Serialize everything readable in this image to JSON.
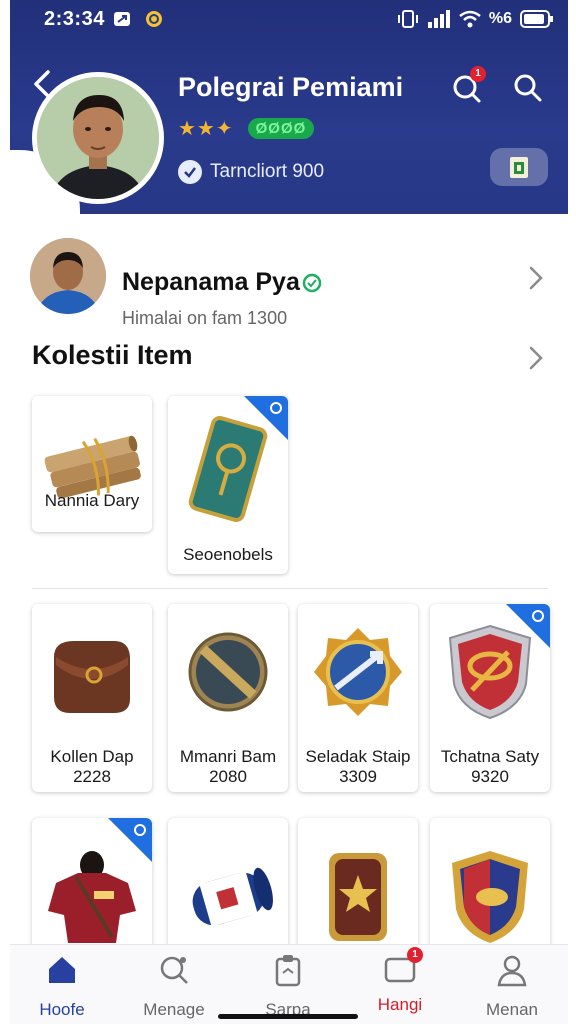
{
  "status_bar": {
    "time": "2:3:34",
    "battery": "%6"
  },
  "profile": {
    "name": "Polegrai Pemiami",
    "stars": "★★✦",
    "rank": "ØØØØ",
    "subtitle": "Tarncliort 900",
    "notification_count": "1"
  },
  "friend": {
    "name": "Nepanama Pya",
    "subtitle": "Himalai on fam 1300"
  },
  "collection": {
    "title": "Kolestii Item",
    "featured": [
      {
        "label": "Nannia Dary",
        "icon": "scroll-bundle-icon",
        "tag": false
      },
      {
        "label": "Seoenobels",
        "icon": "teal-card-icon",
        "tag": true
      }
    ],
    "items": [
      {
        "label": "Kollen Dap",
        "value": "2228",
        "icon": "leather-pouch-icon",
        "tag": false
      },
      {
        "label": "Mmanri Bam",
        "value": "2080",
        "icon": "bronze-coin-icon",
        "tag": false
      },
      {
        "label": "Seladak Staip",
        "value": "3309",
        "icon": "gold-emblem-icon",
        "tag": false
      },
      {
        "label": "Tchatna Saty",
        "value": "9320",
        "icon": "crest-shield-icon",
        "tag": true
      }
    ],
    "items_row2": [
      {
        "icon": "jersey-icon",
        "tag": true
      },
      {
        "icon": "scarf-roll-icon",
        "tag": false
      },
      {
        "icon": "star-shield-icon",
        "tag": false
      },
      {
        "icon": "bird-shield-icon",
        "tag": false
      }
    ]
  },
  "nav": {
    "items": [
      {
        "label": "Hoofe",
        "icon": "home-icon"
      },
      {
        "label": "Menage",
        "icon": "search-icon"
      },
      {
        "label": "Sarpa",
        "icon": "clipboard-icon"
      },
      {
        "label": "Hangi",
        "icon": "message-icon",
        "badge": "1"
      },
      {
        "label": "Menan",
        "icon": "profile-icon"
      }
    ]
  },
  "colors": {
    "header": "#283887",
    "accent": "#2840a0",
    "badge": "#e5202e",
    "tag": "#1f6fe0"
  }
}
